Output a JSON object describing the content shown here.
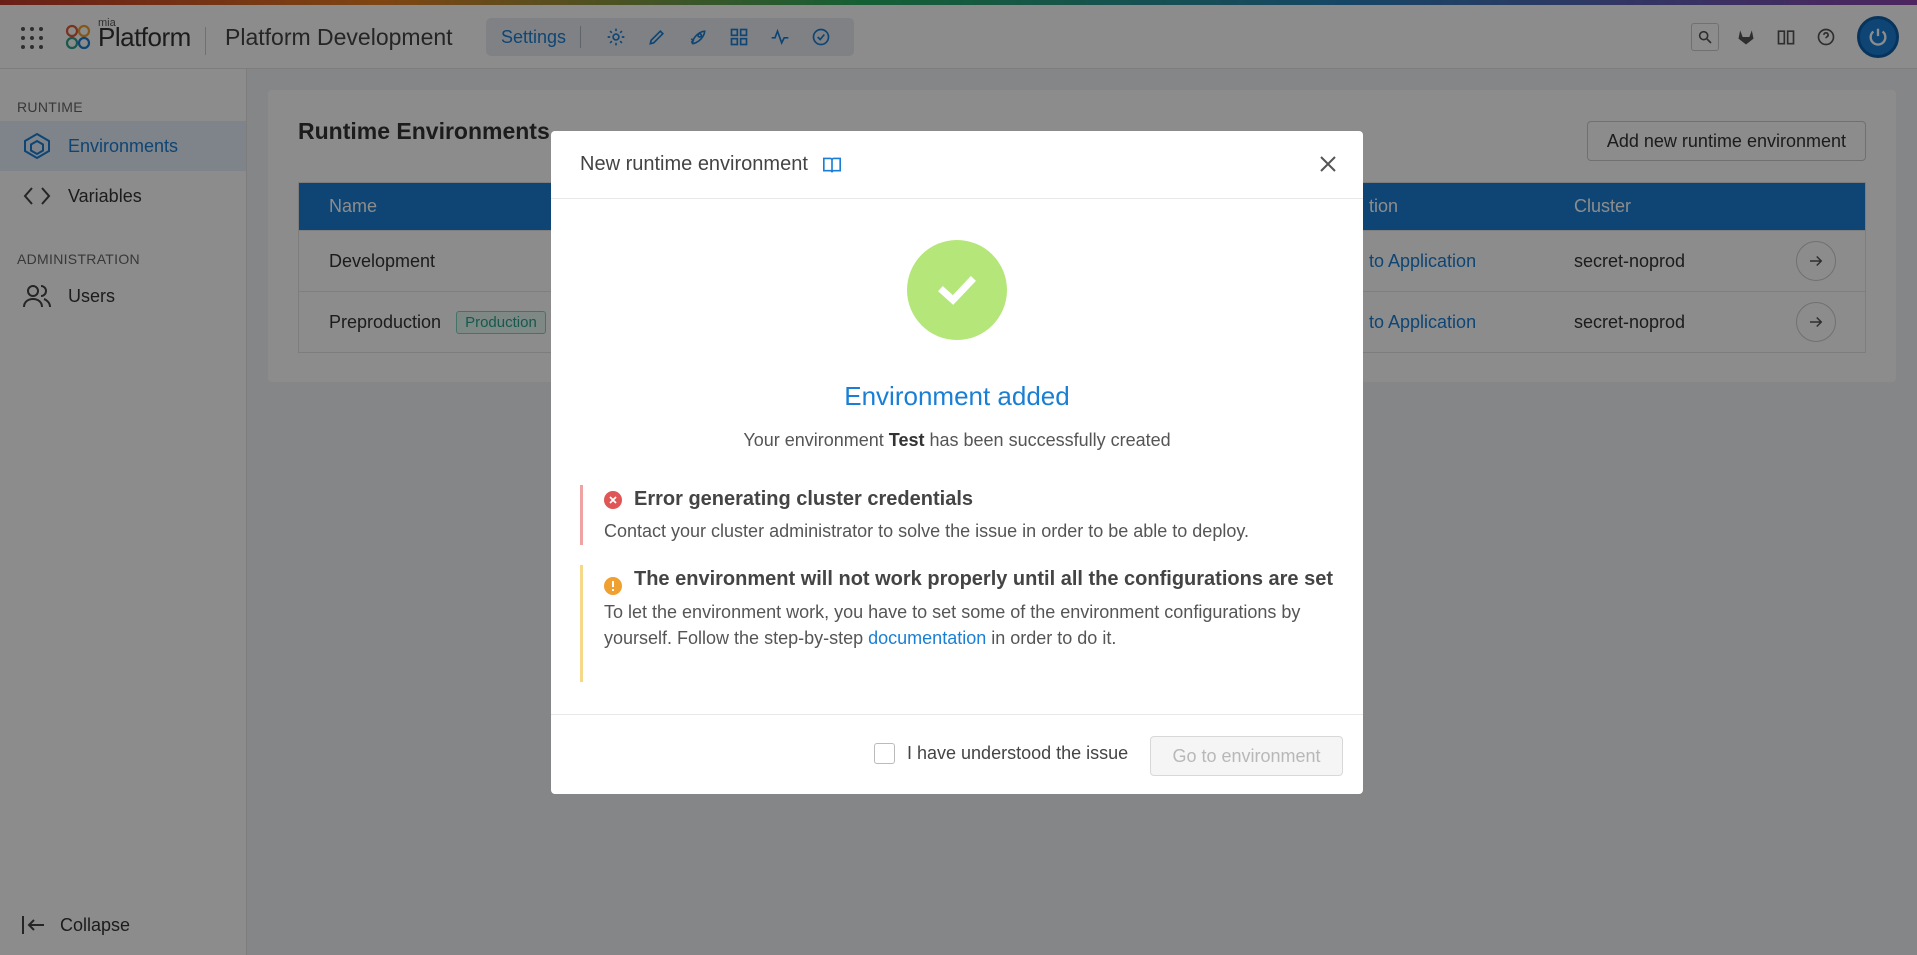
{
  "topbar": {
    "logo_small": "mia",
    "logo_text": "Platform",
    "project_title": "Platform Development",
    "settings_tab": "Settings"
  },
  "sidebar": {
    "runtime_section": "RUNTIME",
    "items": [
      {
        "label": "Environments"
      },
      {
        "label": "Variables"
      }
    ],
    "admin_section": "ADMINISTRATION",
    "admin_items": [
      {
        "label": "Users"
      }
    ],
    "collapse_label": "Collapse"
  },
  "main": {
    "title": "Runtime Environments",
    "add_button": "Add new runtime environment",
    "table": {
      "columns": [
        "Name",
        "tion",
        "Cluster"
      ],
      "rows": [
        {
          "name": "Development",
          "tag": "",
          "app": "to Application",
          "cluster": "secret-noprod"
        },
        {
          "name": "Preproduction",
          "tag": "Production",
          "app": "to Application",
          "cluster": "secret-noprod"
        }
      ]
    }
  },
  "modal": {
    "title": "New runtime environment",
    "success_title": "Environment added",
    "success_sub_prefix": "Your environment",
    "success_env_name": "Test",
    "success_sub_suffix": "has been successfully created",
    "error_title": "Error generating cluster credentials",
    "error_body": "Contact your cluster administrator to solve the issue in order to be able to deploy.",
    "warn_title": "The environment will not work properly until all the configurations are set",
    "warn_body_prefix": "To let the environment work, you have to set some of the environment configurations by yourself. Follow the step-by-step",
    "warn_link": "documentation",
    "warn_body_suffix": "in order to do it.",
    "checkbox_label": "I have understood the issue",
    "go_button": "Go to environment"
  },
  "colors": {
    "accent": "#1a7fd4",
    "success": "#b5e67a",
    "error": "#e05555",
    "warning": "#f0a030"
  }
}
